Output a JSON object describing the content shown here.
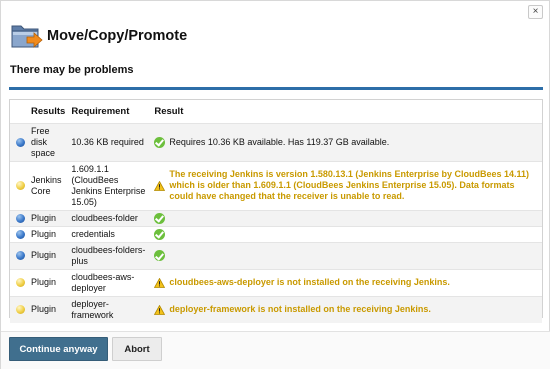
{
  "dialog": {
    "title": "Move/Copy/Promote",
    "close_label": "×",
    "subtitle": "There may be problems"
  },
  "table": {
    "headers": {
      "results": "Results",
      "requirement": "Requirement",
      "result": "Result"
    },
    "rows": [
      {
        "status": "blue",
        "results": "Free disk space",
        "requirement": "10.36 KB required",
        "result_icon": "check-icon",
        "result": "Requires 10.36 KB available. Has 119.37 GB available."
      },
      {
        "status": "yellow",
        "results": "Jenkins Core",
        "requirement": "1.609.1.1 (CloudBees Jenkins Enterprise 15.05)",
        "result_icon": "warning-icon",
        "result": "The receiving Jenkins is version 1.580.13.1 (Jenkins Enterprise by CloudBees 14.11) which is older than 1.609.1.1 (CloudBees Jenkins Enterprise 15.05). Data formats could have changed that the receiver is unable to read."
      },
      {
        "status": "blue",
        "results": "Plugin",
        "requirement": "cloudbees-folder",
        "result_icon": "check-icon",
        "result": ""
      },
      {
        "status": "blue",
        "results": "Plugin",
        "requirement": "credentials",
        "result_icon": "check-icon",
        "result": ""
      },
      {
        "status": "blue",
        "results": "Plugin",
        "requirement": "cloudbees-folders-plus",
        "result_icon": "check-icon",
        "result": ""
      },
      {
        "status": "yellow",
        "results": "Plugin",
        "requirement": "cloudbees-aws-deployer",
        "result_icon": "warning-icon",
        "result": "cloudbees-aws-deployer is not installed on the receiving Jenkins."
      },
      {
        "status": "yellow",
        "results": "Plugin",
        "requirement": "deployer-framework",
        "result_icon": "warning-icon",
        "result": "deployer-framework is not installed on the receiving Jenkins."
      }
    ]
  },
  "buttons": {
    "continue_label": "Continue anyway",
    "abort_label": "Abort"
  },
  "colors": {
    "accent_rule": "#2d6ea8",
    "primary_button": "#406f8e",
    "warning_text": "#c99a00",
    "ok_icon": "#6cbf3c"
  }
}
